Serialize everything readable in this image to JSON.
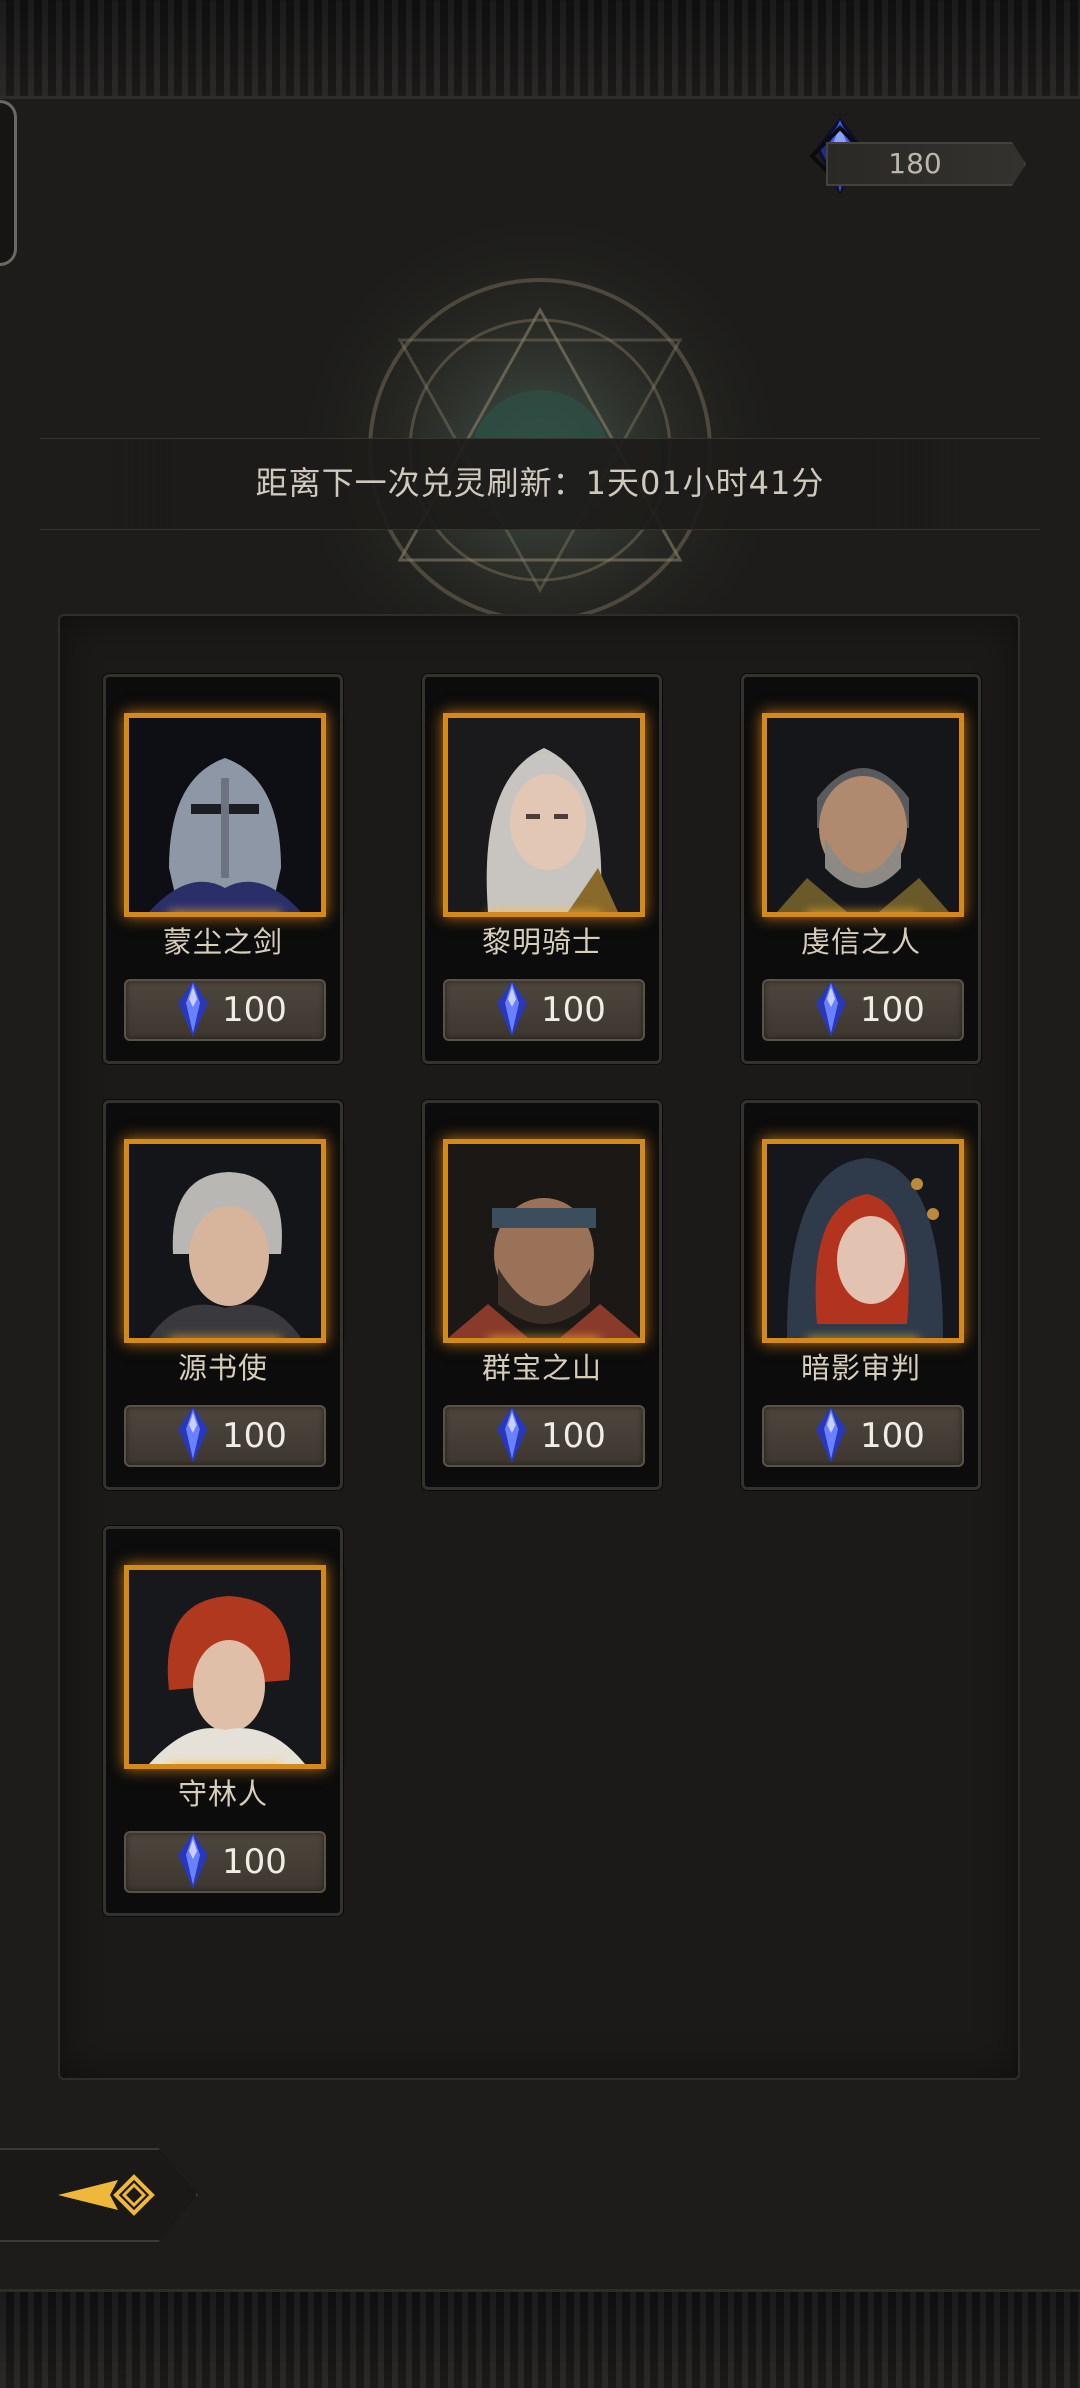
{
  "currency": {
    "icon": "blue-crystal-icon",
    "amount": "180",
    "color": "#3b4fd8"
  },
  "timer": {
    "text": "距离下一次兑灵刷新：1天01小时41分"
  },
  "cards": [
    {
      "name": "蒙尘之剑",
      "price": "100",
      "portrait": "armored-knight-helmet"
    },
    {
      "name": "黎明骑士",
      "price": "100",
      "portrait": "white-haired-woman"
    },
    {
      "name": "虔信之人",
      "price": "100",
      "portrait": "bearded-grey-man"
    },
    {
      "name": "源书使",
      "price": "100",
      "portrait": "silver-haired-youth"
    },
    {
      "name": "群宝之山",
      "price": "100",
      "portrait": "bandana-bearded-man"
    },
    {
      "name": "暗影审判",
      "price": "100",
      "portrait": "red-haired-hooded-woman"
    },
    {
      "name": "守林人",
      "price": "100",
      "portrait": "red-haired-man"
    }
  ],
  "accent": {
    "frame_gold": "#d48a1a",
    "crystal_blue": "#2f46d6"
  }
}
